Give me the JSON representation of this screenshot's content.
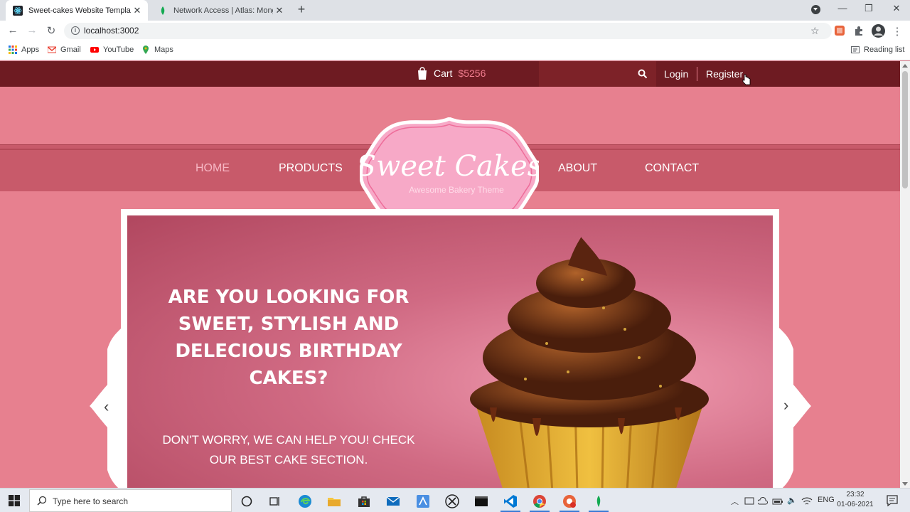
{
  "browser": {
    "tabs": [
      {
        "title": "Sweet-cakes Website Template |",
        "active": true
      },
      {
        "title": "Network Access | Atlas: MongoDB",
        "active": false
      }
    ],
    "new_tab": "+",
    "url": "localhost:3002",
    "bookmarks": [
      "Apps",
      "Gmail",
      "YouTube",
      "Maps"
    ],
    "reading_list": "Reading list"
  },
  "site": {
    "cart_label": "Cart",
    "cart_amount": "$5256",
    "login": "Login",
    "register": "Register",
    "nav": [
      "HOME",
      "PRODUCTS",
      "ABOUT",
      "CONTACT"
    ],
    "logo_title": "Sweet Cakes",
    "logo_subtitle": "Awesome Bakery Theme",
    "slide": {
      "heading": "ARE YOU LOOKING FOR SWEET, STYLISH AND DELECIOUS BIRTHDAY CAKES?",
      "subtext": "DON'T WORRY, WE CAN HELP YOU! CHECK OUR BEST CAKE SECTION."
    }
  },
  "taskbar": {
    "search_placeholder": "Type here to search",
    "language": "ENG",
    "time": "23:32",
    "date": "01-06-2021"
  },
  "colors": {
    "page_bg": "#e7808f",
    "topbar": "#6e1b22",
    "nav_band": "#c85a6a",
    "accent": "#f07d8e"
  }
}
